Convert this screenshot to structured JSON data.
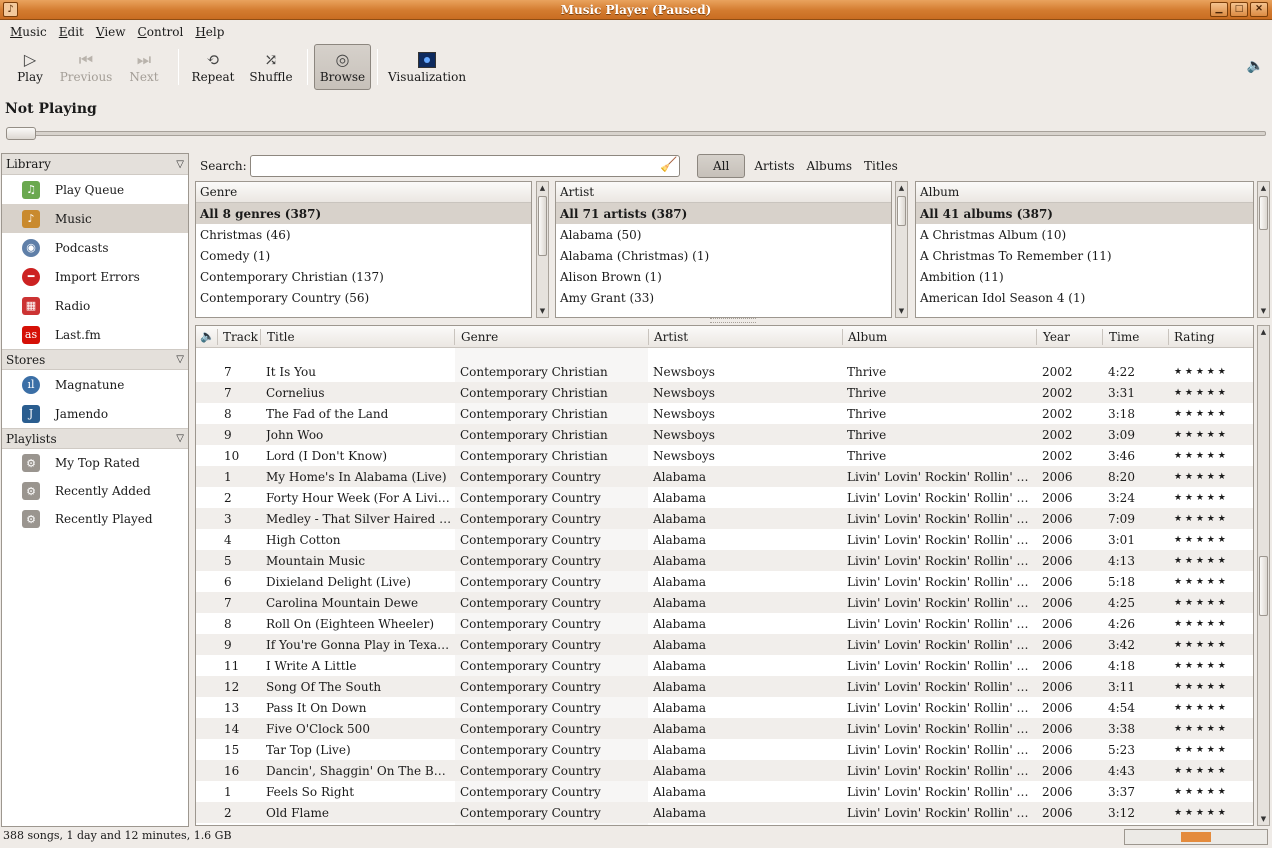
{
  "window": {
    "title": "Music Player (Paused)"
  },
  "menu": [
    "Music",
    "Edit",
    "View",
    "Control",
    "Help"
  ],
  "toolbar": {
    "play": "Play",
    "previous": "Previous",
    "next": "Next",
    "repeat": "Repeat",
    "shuffle": "Shuffle",
    "browse": "Browse",
    "visualization": "Visualization"
  },
  "now_playing": "Not Playing",
  "sidebar": {
    "library_header": "Library",
    "library": [
      {
        "label": "Play Queue",
        "icon": "play-queue-icon",
        "color": "#6aa84f"
      },
      {
        "label": "Music",
        "icon": "music-note-icon",
        "color": "#c98a2e"
      },
      {
        "label": "Podcasts",
        "icon": "podcast-icon",
        "color": "#5f7fa8"
      },
      {
        "label": "Import Errors",
        "icon": "error-icon",
        "color": "#cc2222"
      },
      {
        "label": "Radio",
        "icon": "radio-icon",
        "color": "#cc3333"
      },
      {
        "label": "Last.fm",
        "icon": "lastfm-icon",
        "color": "#d51007"
      }
    ],
    "stores_header": "Stores",
    "stores": [
      {
        "label": "Magnatune",
        "icon": "magnatune-icon",
        "color": "#3b6fa6"
      },
      {
        "label": "Jamendo",
        "icon": "jamendo-icon",
        "color": "#2a5d8f"
      }
    ],
    "playlists_header": "Playlists",
    "playlists": [
      {
        "label": "My Top Rated",
        "icon": "smart-playlist-icon"
      },
      {
        "label": "Recently Added",
        "icon": "smart-playlist-icon"
      },
      {
        "label": "Recently Played",
        "icon": "smart-playlist-icon"
      }
    ]
  },
  "search": {
    "label": "Search:",
    "value": ""
  },
  "filters": [
    "All",
    "Artists",
    "Albums",
    "Titles"
  ],
  "browser": {
    "genre": {
      "header": "Genre",
      "rows": [
        "All 8 genres (387)",
        "Christmas (46)",
        "Comedy (1)",
        "Contemporary Christian (137)",
        "Contemporary Country (56)"
      ]
    },
    "artist": {
      "header": "Artist",
      "rows": [
        "All 71 artists (387)",
        "Alabama (50)",
        "Alabama (Christmas) (1)",
        "Alison Brown (1)",
        "Amy Grant (33)"
      ]
    },
    "album": {
      "header": "Album",
      "rows": [
        "All 41 albums (387)",
        "A Christmas Album (10)",
        "A Christmas To Remember (11)",
        "Ambition (11)",
        "American Idol Season 4 (1)"
      ]
    }
  },
  "songs": {
    "columns": [
      "Track",
      "Title",
      "Genre",
      "Artist",
      "Album",
      "Year",
      "Time",
      "Rating"
    ],
    "rows": [
      [
        "7",
        "It Is You",
        "Contemporary Christian",
        "Newsboys",
        "Thrive",
        "2002",
        "4:22"
      ],
      [
        "7",
        "Cornelius",
        "Contemporary Christian",
        "Newsboys",
        "Thrive",
        "2002",
        "3:31"
      ],
      [
        "8",
        "The Fad of the Land",
        "Contemporary Christian",
        "Newsboys",
        "Thrive",
        "2002",
        "3:18"
      ],
      [
        "9",
        "John Woo",
        "Contemporary Christian",
        "Newsboys",
        "Thrive",
        "2002",
        "3:09"
      ],
      [
        "10",
        "Lord (I Don't Know)",
        "Contemporary Christian",
        "Newsboys",
        "Thrive",
        "2002",
        "3:46"
      ],
      [
        "1",
        "My Home's In Alabama (Live)",
        "Contemporary Country",
        "Alabama",
        "Livin' Lovin' Rockin' Rollin' - ...",
        "2006",
        "8:20"
      ],
      [
        "2",
        "Forty Hour Week (For A Livin')",
        "Contemporary Country",
        "Alabama",
        "Livin' Lovin' Rockin' Rollin' - ...",
        "2006",
        "3:24"
      ],
      [
        "3",
        "Medley - That Silver Haired D...",
        "Contemporary Country",
        "Alabama",
        "Livin' Lovin' Rockin' Rollin' - ...",
        "2006",
        "7:09"
      ],
      [
        "4",
        "High Cotton",
        "Contemporary Country",
        "Alabama",
        "Livin' Lovin' Rockin' Rollin' - ...",
        "2006",
        "3:01"
      ],
      [
        "5",
        "Mountain Music",
        "Contemporary Country",
        "Alabama",
        "Livin' Lovin' Rockin' Rollin' - ...",
        "2006",
        "4:13"
      ],
      [
        "6",
        "Dixieland Delight (Live)",
        "Contemporary Country",
        "Alabama",
        "Livin' Lovin' Rockin' Rollin' - ...",
        "2006",
        "5:18"
      ],
      [
        "7",
        "Carolina Mountain Dewe",
        "Contemporary Country",
        "Alabama",
        "Livin' Lovin' Rockin' Rollin' - ...",
        "2006",
        "4:25"
      ],
      [
        "8",
        "Roll On (Eighteen Wheeler)",
        "Contemporary Country",
        "Alabama",
        "Livin' Lovin' Rockin' Rollin' - ...",
        "2006",
        "4:26"
      ],
      [
        "9",
        "If You're Gonna Play in Texas (...",
        "Contemporary Country",
        "Alabama",
        "Livin' Lovin' Rockin' Rollin' - ...",
        "2006",
        "3:42"
      ],
      [
        "11",
        "I Write A Little",
        "Contemporary Country",
        "Alabama",
        "Livin' Lovin' Rockin' Rollin' - ...",
        "2006",
        "4:18"
      ],
      [
        "12",
        "Song Of The South",
        "Contemporary Country",
        "Alabama",
        "Livin' Lovin' Rockin' Rollin' - ...",
        "2006",
        "3:11"
      ],
      [
        "13",
        "Pass It On Down",
        "Contemporary Country",
        "Alabama",
        "Livin' Lovin' Rockin' Rollin' - ...",
        "2006",
        "4:54"
      ],
      [
        "14",
        "Five O'Clock 500",
        "Contemporary Country",
        "Alabama",
        "Livin' Lovin' Rockin' Rollin' - ...",
        "2006",
        "3:38"
      ],
      [
        "15",
        "Tar Top (Live)",
        "Contemporary Country",
        "Alabama",
        "Livin' Lovin' Rockin' Rollin' - ...",
        "2006",
        "5:23"
      ],
      [
        "16",
        "Dancin', Shaggin' On The Bo...",
        "Contemporary Country",
        "Alabama",
        "Livin' Lovin' Rockin' Rollin' - ...",
        "2006",
        "4:43"
      ],
      [
        "1",
        "Feels So Right",
        "Contemporary Country",
        "Alabama",
        "Livin' Lovin' Rockin' Rollin' - ...",
        "2006",
        "3:37"
      ],
      [
        "2",
        "Old Flame",
        "Contemporary Country",
        "Alabama",
        "Livin' Lovin' Rockin' Rollin' - ...",
        "2006",
        "3:12"
      ]
    ],
    "rating_glyphs": "★ ★ ★ ★ ★"
  },
  "status": "388 songs, 1 day and 12 minutes, 1.6 GB",
  "colors": {
    "titlebar": "#d37b2f",
    "selection": "#d8d2cb",
    "meter": "#e48b3d"
  }
}
